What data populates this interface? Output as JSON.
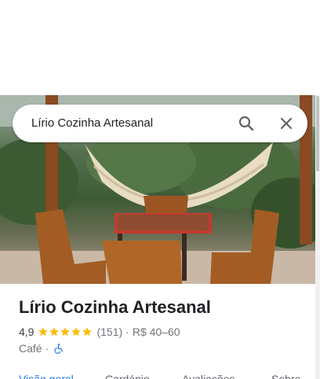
{
  "search": {
    "query": "Lírio Cozinha Artesanal"
  },
  "place": {
    "name": "Lírio Cozinha Artesanal",
    "rating": "4,9",
    "stars": 5,
    "review_count": "(151)",
    "separator": "·",
    "price_range": "R$ 40–60",
    "category": "Café",
    "category_separator": "·"
  },
  "tabs": [
    {
      "label": "Visão geral",
      "active": true
    },
    {
      "label": "Cardápio",
      "active": false
    },
    {
      "label": "Avaliações",
      "active": false
    },
    {
      "label": "Sobre",
      "active": false
    }
  ],
  "icons": {
    "search": "search-icon",
    "close": "close-icon",
    "star": "star-icon",
    "accessibility": "wheelchair-icon"
  },
  "colors": {
    "star": "#fbbc04",
    "accent": "#1a73e8",
    "accessibility": "#1a73e8",
    "text_primary": "#202124",
    "text_secondary": "#70757a"
  }
}
